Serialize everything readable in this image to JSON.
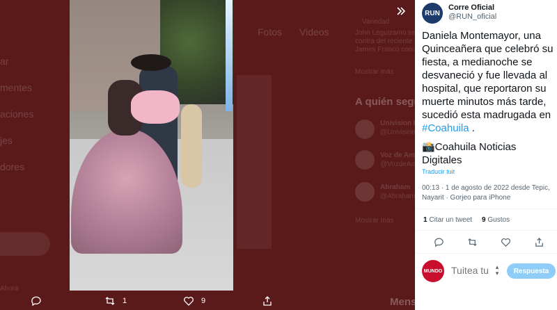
{
  "background": {
    "sidebar": [
      "ar",
      "mentes",
      "aciones",
      "jes",
      "dores"
    ],
    "tabs": [
      "Fotos",
      "Videos"
    ],
    "trend": {
      "author": "Variedad",
      "line1": "John Leguizamo se",
      "line2": "contra del reciente",
      "line3": "James Franco com",
      "line4": "Mostrar más"
    },
    "follow_title": "A quién seguir",
    "follow_items": [
      {
        "name": "Univision L",
        "handle": "@Univision"
      },
      {
        "name": "Voz de Am",
        "handle": "@VozdeAme"
      },
      {
        "name": "Abraham",
        "handle": "@AbrahamM"
      }
    ],
    "show_more": "Mostrar más",
    "footer": [
      "Ahora",
      "Mensajes"
    ]
  },
  "media": {
    "alt": "video"
  },
  "overlay": {
    "expand_icon": "double-chevron-right-icon",
    "retweet_count": "1",
    "like_count": "9"
  },
  "tweet": {
    "display_name": "Corre Oficial",
    "handle": "@RUN_oficial",
    "avatar_text": "RUN",
    "text": "Daniela Montemayor, una Quinceañera que celebró su fiesta, a medianoche se desvaneció y fue llevada al hospital, que reportaron su muerte minutos más tarde, sucedió esta madrugada en ",
    "hashtag": "#Coahuila",
    "text_end": " .",
    "source": "📸Coahuila Noticias Digitales",
    "translate": "Traducir tuit",
    "meta": "00:13 · 1 de agosto de 2022 desde Tepic, Nayarit · Gorjeo para iPhone",
    "retweet_count": "1",
    "retweet_label": "Citar un tweet",
    "like_count": "9",
    "like_label": "Gustos"
  },
  "reply": {
    "avatar_text": "MUNDO",
    "placeholder": "Tuitea tu",
    "button": "Respuesta"
  },
  "colors": {
    "accent": "#1d9bf0",
    "reply_button": "#8ecdf8",
    "dim_background": "#5a1a1a"
  }
}
